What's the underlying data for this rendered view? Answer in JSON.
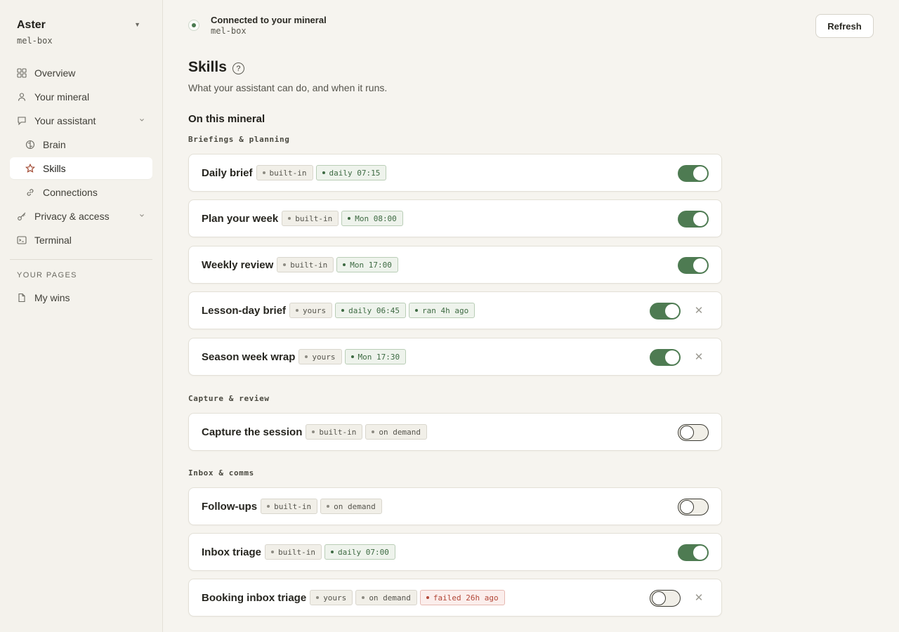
{
  "workspace": {
    "name": "Aster",
    "host": "mel-box"
  },
  "sidebar": {
    "items": [
      {
        "label": "Overview"
      },
      {
        "label": "Your mineral"
      },
      {
        "label": "Your assistant"
      },
      {
        "label": "Brain"
      },
      {
        "label": "Skills"
      },
      {
        "label": "Connections"
      },
      {
        "label": "Privacy & access"
      },
      {
        "label": "Terminal"
      }
    ],
    "pages_label": "YOUR PAGES",
    "pages": [
      {
        "label": "My wins"
      }
    ]
  },
  "status": {
    "title": "Connected to your mineral",
    "host": "mel-box"
  },
  "header": {
    "refresh_label": "Refresh"
  },
  "page": {
    "title": "Skills",
    "help": "?",
    "subtitle": "What your assistant can do, and when it runs.",
    "section_title": "On this mineral"
  },
  "groups": [
    {
      "label": "Briefings & planning",
      "skills": [
        {
          "name": "Daily brief",
          "tags": [
            {
              "text": "built-in",
              "tone": "neutral"
            },
            {
              "text": "daily 07:15",
              "tone": "green"
            }
          ],
          "enabled": true,
          "removable": false
        },
        {
          "name": "Plan your week",
          "tags": [
            {
              "text": "built-in",
              "tone": "neutral"
            },
            {
              "text": "Mon 08:00",
              "tone": "green"
            }
          ],
          "enabled": true,
          "removable": false
        },
        {
          "name": "Weekly review",
          "tags": [
            {
              "text": "built-in",
              "tone": "neutral"
            },
            {
              "text": "Mon 17:00",
              "tone": "green"
            }
          ],
          "enabled": true,
          "removable": false
        },
        {
          "name": "Lesson-day brief",
          "tags": [
            {
              "text": "yours",
              "tone": "neutral"
            },
            {
              "text": "daily 06:45",
              "tone": "green"
            },
            {
              "text": "ran 4h ago",
              "tone": "green"
            }
          ],
          "enabled": true,
          "removable": true
        },
        {
          "name": "Season week wrap",
          "tags": [
            {
              "text": "yours",
              "tone": "neutral"
            },
            {
              "text": "Mon 17:30",
              "tone": "green"
            }
          ],
          "enabled": true,
          "removable": true
        }
      ]
    },
    {
      "label": "Capture & review",
      "skills": [
        {
          "name": "Capture the session",
          "tags": [
            {
              "text": "built-in",
              "tone": "neutral"
            },
            {
              "text": "on demand",
              "tone": "neutral"
            }
          ],
          "enabled": false,
          "removable": false
        }
      ]
    },
    {
      "label": "Inbox & comms",
      "skills": [
        {
          "name": "Follow-ups",
          "tags": [
            {
              "text": "built-in",
              "tone": "neutral"
            },
            {
              "text": "on demand",
              "tone": "neutral"
            }
          ],
          "enabled": false,
          "removable": false
        },
        {
          "name": "Inbox triage",
          "tags": [
            {
              "text": "built-in",
              "tone": "neutral"
            },
            {
              "text": "daily 07:00",
              "tone": "green"
            }
          ],
          "enabled": true,
          "removable": false
        },
        {
          "name": "Booking inbox triage",
          "tags": [
            {
              "text": "yours",
              "tone": "neutral"
            },
            {
              "text": "on demand",
              "tone": "neutral"
            },
            {
              "text": "failed 26h ago",
              "tone": "red"
            }
          ],
          "enabled": false,
          "removable": true
        }
      ]
    }
  ],
  "colors": {
    "accent_green": "#4e7b52",
    "error_red": "#b24637",
    "background": "#f6f4ef"
  },
  "icons": {
    "remove": "close-icon"
  }
}
